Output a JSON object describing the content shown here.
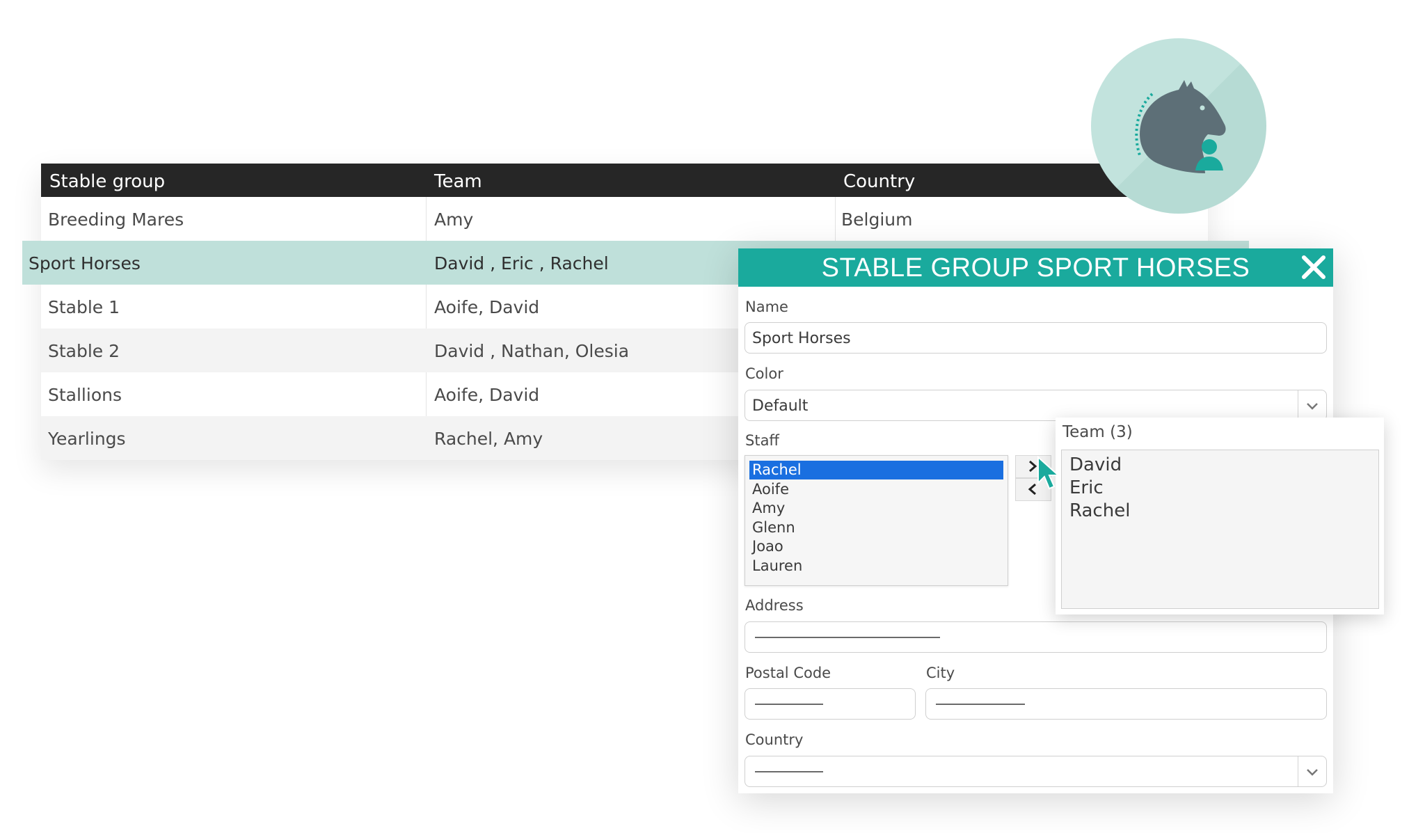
{
  "table": {
    "headers": [
      "Stable group",
      "Team",
      "Country"
    ],
    "rows": [
      {
        "group": "Breeding Mares",
        "team": "Amy",
        "country": "Belgium"
      },
      {
        "group": "Sport Horses",
        "team": "David , Eric , Rachel",
        "country": ""
      },
      {
        "group": "Stable 1",
        "team": "Aoife, David",
        "country": ""
      },
      {
        "group": "Stable 2",
        "team": "David , Nathan, Olesia",
        "country": ""
      },
      {
        "group": "Stallions",
        "team": "Aoife, David",
        "country": ""
      },
      {
        "group": "Yearlings",
        "team": "Rachel, Amy",
        "country": ""
      }
    ]
  },
  "dialog": {
    "title": "STABLE GROUP SPORT HORSES",
    "name_label": "Name",
    "name_value": "Sport Horses",
    "color_label": "Color",
    "color_value": "Default",
    "staff_label": "Staff",
    "staff_options": [
      "Rachel",
      "Aoife",
      "Amy",
      "Glenn",
      "Joao",
      "Lauren"
    ],
    "staff_selected": "Rachel",
    "address_label": "Address",
    "postal_label": "Postal Code",
    "city_label": "City",
    "country_label": "Country"
  },
  "team_popup": {
    "title": "Team (3)",
    "members": [
      "David",
      "Eric",
      "Rachel"
    ]
  },
  "colors": {
    "accent": "#1aaa9d",
    "selected_row": "#bfe0da",
    "header_bg": "#262626",
    "list_selection": "#1a6fe0"
  },
  "icons": {
    "logo": "horse-head-with-person-logo",
    "close": "close-icon",
    "move_right": "chevron-right-icon",
    "move_left": "chevron-left-icon",
    "dropdown": "chevron-down-icon",
    "cursor": "mouse-pointer-icon"
  }
}
